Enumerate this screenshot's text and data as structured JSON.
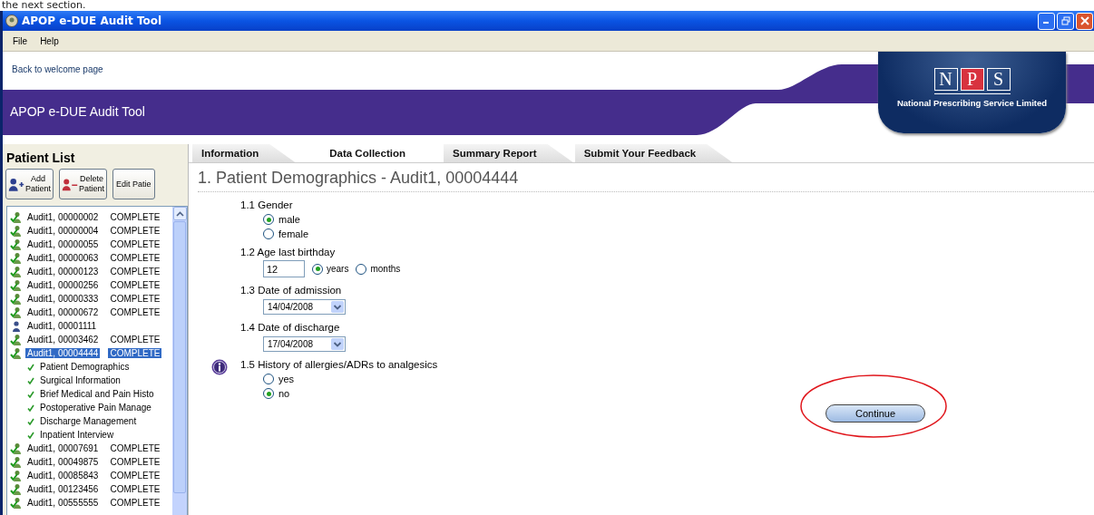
{
  "caption": "the next section.",
  "window": {
    "title": "APOP e-DUE Audit Tool"
  },
  "menu": [
    "File",
    "Help"
  ],
  "header": {
    "link": "Back to welcome page",
    "title": "APOP e-DUE Audit Tool",
    "logo_letters": [
      "N",
      "P",
      "S"
    ],
    "logo_text": "National Prescribing Service Limited"
  },
  "patient_list": {
    "title": "Patient List",
    "buttons": [
      {
        "kind": "add",
        "lines": [
          "Add",
          "Patient"
        ]
      },
      {
        "kind": "delete",
        "lines": [
          "Delete",
          "Patient"
        ]
      },
      {
        "kind": "edit",
        "lines": [
          "Edit Patie"
        ]
      }
    ],
    "items": [
      {
        "kind": "complete",
        "name": "Audit1, 00000002",
        "status": "COMPLETE",
        "selected": false
      },
      {
        "kind": "complete",
        "name": "Audit1, 00000004",
        "status": "COMPLETE",
        "selected": false
      },
      {
        "kind": "complete",
        "name": "Audit1, 00000055",
        "status": "COMPLETE",
        "selected": false
      },
      {
        "kind": "complete",
        "name": "Audit1, 00000063",
        "status": "COMPLETE",
        "selected": false
      },
      {
        "kind": "complete",
        "name": "Audit1, 00000123",
        "status": "COMPLETE",
        "selected": false
      },
      {
        "kind": "complete",
        "name": "Audit1, 00000256",
        "status": "COMPLETE",
        "selected": false
      },
      {
        "kind": "complete",
        "name": "Audit1, 00000333",
        "status": "COMPLETE",
        "selected": false
      },
      {
        "kind": "complete",
        "name": "Audit1, 00000672",
        "status": "COMPLETE",
        "selected": false
      },
      {
        "kind": "incomplete",
        "name": "Audit1, 00001111",
        "selected": false
      },
      {
        "kind": "complete",
        "name": "Audit1, 00003462",
        "status": "COMPLETE",
        "selected": false
      },
      {
        "kind": "complete",
        "name": "Audit1, 00004444",
        "status": "COMPLETE",
        "selected": true,
        "children": [
          {
            "label": "Patient Demographics",
            "checked": true
          },
          {
            "label": "Surgical Information",
            "checked": true
          },
          {
            "label": "Brief Medical and Pain Histo",
            "checked": true
          },
          {
            "label": "Postoperative Pain Manage",
            "checked": true
          },
          {
            "label": "Discharge Management",
            "checked": true
          },
          {
            "label": "Inpatient Interview",
            "checked": true
          }
        ]
      },
      {
        "kind": "complete",
        "name": "Audit1, 00007691",
        "status": "COMPLETE",
        "selected": false
      },
      {
        "kind": "complete",
        "name": "Audit1, 00049875",
        "status": "COMPLETE",
        "selected": false
      },
      {
        "kind": "complete",
        "name": "Audit1, 00085843",
        "status": "COMPLETE",
        "selected": false
      },
      {
        "kind": "complete",
        "name": "Audit1, 00123456",
        "status": "COMPLETE",
        "selected": false
      },
      {
        "kind": "complete",
        "name": "Audit1, 00555555",
        "status": "COMPLETE",
        "selected": false
      }
    ]
  },
  "tabs": [
    {
      "label": "Information",
      "selected": false
    },
    {
      "label": "Data Collection",
      "selected": true
    },
    {
      "label": "Summary Report",
      "selected": false
    },
    {
      "label": "Submit Your Feedback",
      "selected": false
    }
  ],
  "form": {
    "heading": "1. Patient Demographics - Audit1, 00004444",
    "questions": [
      {
        "kind": "radio",
        "label": "1.1 Gender",
        "info": false,
        "options": [
          {
            "label": "male",
            "selected": true
          },
          {
            "label": "female",
            "selected": false
          }
        ]
      },
      {
        "kind": "age",
        "label": "1.2 Age last birthday",
        "info": false,
        "value": "12",
        "options": [
          {
            "label": "years",
            "selected": true
          },
          {
            "label": "months",
            "selected": false
          }
        ]
      },
      {
        "kind": "date",
        "label": "1.3 Date of admission",
        "info": false,
        "value": "14/04/2008"
      },
      {
        "kind": "date",
        "label": "1.4 Date of discharge",
        "info": false,
        "value": "17/04/2008"
      },
      {
        "kind": "radio",
        "label": "1.5 History of allergies/ADRs to analgesics",
        "info": true,
        "options": [
          {
            "label": "yes",
            "selected": false
          },
          {
            "label": "no",
            "selected": true
          }
        ]
      }
    ],
    "button": "Continue"
  }
}
